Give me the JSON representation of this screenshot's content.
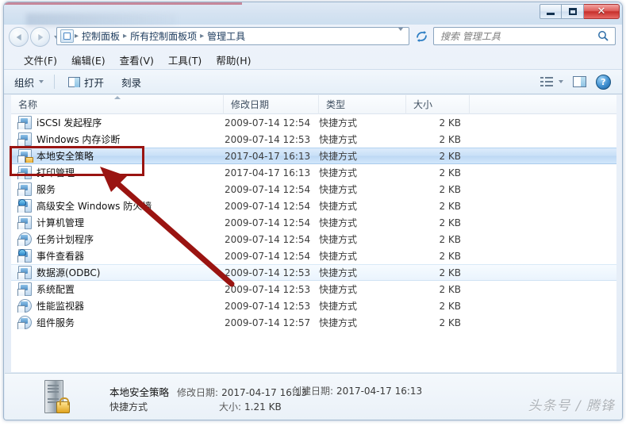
{
  "window": {
    "title": "",
    "buttons": {
      "minimize": "—",
      "maximize": "❐",
      "close": "✕"
    }
  },
  "navbar": {
    "breadcrumb": [
      "控制面板",
      "所有控制面板项",
      "管理工具"
    ],
    "separator": "▸",
    "back_tooltip": "后退",
    "forward_tooltip": "前进",
    "refresh_icon": "refresh-icon"
  },
  "search": {
    "placeholder": "搜索 管理工具",
    "value": ""
  },
  "menubar": {
    "items": [
      "文件(F)",
      "编辑(E)",
      "查看(V)",
      "工具(T)",
      "帮助(H)"
    ]
  },
  "toolbar": {
    "organize": "组织",
    "open": "打开",
    "burn": "刻录",
    "view_icon": "view-list-icon",
    "pane_icon": "preview-pane-icon",
    "help_icon": "help-icon"
  },
  "columns": [
    {
      "key": "name",
      "label": "名称",
      "sort": "asc"
    },
    {
      "key": "date",
      "label": "修改日期",
      "sort": ""
    },
    {
      "key": "type",
      "label": "类型",
      "sort": ""
    },
    {
      "key": "size",
      "label": "大小",
      "sort": ""
    }
  ],
  "rows": [
    {
      "name": "iSCSI 发起程序",
      "date": "2009-07-14 12:54",
      "type": "快捷方式",
      "size": "2 KB",
      "state": ""
    },
    {
      "name": "Windows 内存诊断",
      "date": "2009-07-14 12:53",
      "type": "快捷方式",
      "size": "2 KB",
      "state": ""
    },
    {
      "name": "本地安全策略",
      "date": "2017-04-17 16:13",
      "type": "快捷方式",
      "size": "2 KB",
      "state": "selected"
    },
    {
      "name": "打印管理",
      "date": "2017-04-17 16:13",
      "type": "快捷方式",
      "size": "2 KB",
      "state": ""
    },
    {
      "name": "服务",
      "date": "2009-07-14 12:54",
      "type": "快捷方式",
      "size": "2 KB",
      "state": ""
    },
    {
      "name": "高级安全 Windows 防火墙",
      "date": "2009-07-14 12:54",
      "type": "快捷方式",
      "size": "2 KB",
      "state": ""
    },
    {
      "name": "计算机管理",
      "date": "2009-07-14 12:54",
      "type": "快捷方式",
      "size": "2 KB",
      "state": ""
    },
    {
      "name": "任务计划程序",
      "date": "2009-07-14 12:54",
      "type": "快捷方式",
      "size": "2 KB",
      "state": ""
    },
    {
      "name": "事件查看器",
      "date": "2009-07-14 12:54",
      "type": "快捷方式",
      "size": "2 KB",
      "state": ""
    },
    {
      "name": "数据源(ODBC)",
      "date": "2009-07-14 12:53",
      "type": "快捷方式",
      "size": "2 KB",
      "state": "hover"
    },
    {
      "name": "系统配置",
      "date": "2009-07-14 12:53",
      "type": "快捷方式",
      "size": "2 KB",
      "state": ""
    },
    {
      "name": "性能监视器",
      "date": "2009-07-14 12:53",
      "type": "快捷方式",
      "size": "2 KB",
      "state": ""
    },
    {
      "name": "组件服务",
      "date": "2009-07-14 12:57",
      "type": "快捷方式",
      "size": "2 KB",
      "state": ""
    }
  ],
  "details": {
    "title": "本地安全策略",
    "modified_label": "修改日期:",
    "modified_value": "2017-04-17 16:13",
    "created_label": "创建日期:",
    "created_value": "2017-04-17 16:13",
    "type_value": "快捷方式",
    "size_label": "大小:",
    "size_value": "1.21 KB"
  },
  "watermark": "头条号 / 腾锋",
  "colors": {
    "accent": "#1c5f9e",
    "annotation": "#9a1411",
    "selection": "#bdd8f4",
    "close_button": "#c62f2b"
  }
}
